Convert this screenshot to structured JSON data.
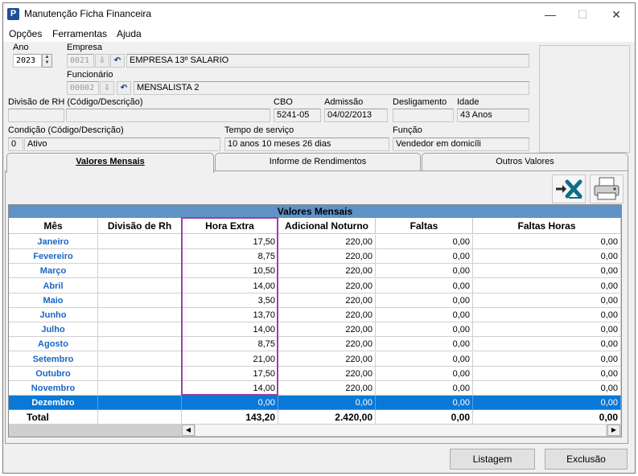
{
  "window": {
    "title": "Manutenção Ficha Financeira",
    "controls": {
      "minimize": "—",
      "maximize": "☐",
      "close": "✕"
    }
  },
  "menu": [
    "Opções",
    "Ferramentas",
    "Ajuda"
  ],
  "form": {
    "ano_label": "Ano",
    "ano_value": "2023",
    "empresa_label": "Empresa",
    "empresa_code": "0021",
    "empresa_name": "EMPRESA 13º SALARIO",
    "funcionario_label": "Funcionário",
    "funcionario_code": "00002",
    "funcionario_name": "MENSALISTA 2",
    "divisao_label": "Divisão de RH (Código/Descrição)",
    "divisao_code": "",
    "divisao_desc": "",
    "cbo_label": "CBO",
    "cbo_value": "5241-05",
    "admissao_label": "Admissão",
    "admissao_value": "04/02/2013",
    "desligamento_label": "Desligamento",
    "desligamento_value": "",
    "idade_label": "Idade",
    "idade_value": "43 Anos",
    "condicao_label": "Condição (Código/Descrição)",
    "condicao_code": "0",
    "condicao_desc": "Ativo",
    "tempo_label": "Tempo de serviço",
    "tempo_value": "10 anos 10 meses 26 dias",
    "funcao_label": "Função",
    "funcao_value": "Vendedor em domicíli"
  },
  "tabs": [
    {
      "label": "Valores Mensais",
      "active": true
    },
    {
      "label": "Informe de Rendimentos",
      "active": false
    },
    {
      "label": "Outros Valores",
      "active": false
    }
  ],
  "grid": {
    "title": "Valores Mensais",
    "columns": [
      "Mês",
      "Divisão de Rh",
      "Hora Extra",
      "Adicional Noturno",
      "Faltas",
      "Faltas Horas"
    ],
    "rows": [
      {
        "mes": "Janeiro",
        "divisao": "",
        "hora_extra": "17,50",
        "adicional": "220,00",
        "faltas": "0,00",
        "faltas_horas": "0,00"
      },
      {
        "mes": "Fevereiro",
        "divisao": "",
        "hora_extra": "8,75",
        "adicional": "220,00",
        "faltas": "0,00",
        "faltas_horas": "0,00"
      },
      {
        "mes": "Março",
        "divisao": "",
        "hora_extra": "10,50",
        "adicional": "220,00",
        "faltas": "0,00",
        "faltas_horas": "0,00"
      },
      {
        "mes": "Abril",
        "divisao": "",
        "hora_extra": "14,00",
        "adicional": "220,00",
        "faltas": "0,00",
        "faltas_horas": "0,00"
      },
      {
        "mes": "Maio",
        "divisao": "",
        "hora_extra": "3,50",
        "adicional": "220,00",
        "faltas": "0,00",
        "faltas_horas": "0,00"
      },
      {
        "mes": "Junho",
        "divisao": "",
        "hora_extra": "13,70",
        "adicional": "220,00",
        "faltas": "0,00",
        "faltas_horas": "0,00"
      },
      {
        "mes": "Julho",
        "divisao": "",
        "hora_extra": "14,00",
        "adicional": "220,00",
        "faltas": "0,00",
        "faltas_horas": "0,00"
      },
      {
        "mes": "Agosto",
        "divisao": "",
        "hora_extra": "8,75",
        "adicional": "220,00",
        "faltas": "0,00",
        "faltas_horas": "0,00"
      },
      {
        "mes": "Setembro",
        "divisao": "",
        "hora_extra": "21,00",
        "adicional": "220,00",
        "faltas": "0,00",
        "faltas_horas": "0,00"
      },
      {
        "mes": "Outubro",
        "divisao": "",
        "hora_extra": "17,50",
        "adicional": "220,00",
        "faltas": "0,00",
        "faltas_horas": "0,00"
      },
      {
        "mes": "Novembro",
        "divisao": "",
        "hora_extra": "14,00",
        "adicional": "220,00",
        "faltas": "0,00",
        "faltas_horas": "0,00"
      },
      {
        "mes": "Dezembro",
        "divisao": "",
        "hora_extra": "0,00",
        "adicional": "0,00",
        "faltas": "0,00",
        "faltas_horas": "0,00",
        "selected": true
      }
    ],
    "total": {
      "label": "Total",
      "hora_extra": "143,20",
      "adicional": "2.420,00",
      "faltas": "0,00",
      "faltas_horas": "0,00"
    }
  },
  "toolbar": {
    "excel_icon": "excel-export-icon",
    "print_icon": "printer-icon"
  },
  "buttons": {
    "listagem": "Listagem",
    "exclusao": "Exclusão"
  },
  "colors": {
    "accent": "#0a78d7",
    "grid_title": "#5f93c7",
    "month_text": "#1a66c4",
    "highlight": "#9b3fa8"
  }
}
